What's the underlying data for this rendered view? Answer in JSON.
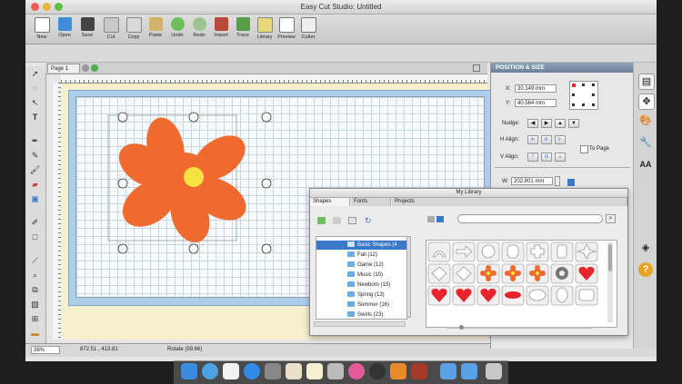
{
  "window": {
    "title": "Easy Cut Studio: Untitled"
  },
  "toolbar": {
    "items": [
      "New",
      "Open",
      "Save",
      "Cut",
      "Copy",
      "Paste",
      "Undo",
      "Redo",
      "Import",
      "Trace",
      "Library",
      "Preview",
      "Cutter"
    ]
  },
  "document": {
    "page_tab": "Page 1"
  },
  "status": {
    "zoom": "38%",
    "coords": "872.51 , 413.81",
    "message": "Rotate (59.66)"
  },
  "position_size": {
    "title": "POSITION & SIZE",
    "x_label": "X:",
    "x_value": "30.149 mm",
    "y_label": "Y:",
    "y_value": "40.564 mm",
    "nudge_label": "Nudge:",
    "h_align_label": "H Align:",
    "v_align_label": "V Align:",
    "to_page_label": "To Page",
    "w_label": "W:",
    "w_value": "202.801 mm"
  },
  "library": {
    "title": "My Library",
    "tabs": [
      "Shapes",
      "Fonts",
      "Projects"
    ],
    "tree": [
      {
        "label": "Basic Shapes (4",
        "selected": true
      },
      {
        "label": "Fall (12)"
      },
      {
        "label": "Game (12)"
      },
      {
        "label": "Music (10)"
      },
      {
        "label": "Newborn (15)"
      },
      {
        "label": "Spring (13)"
      },
      {
        "label": "Summer (16)"
      },
      {
        "label": "Swirls (23)"
      }
    ]
  },
  "colors": {
    "flower": "#ee6a2e",
    "flower_center": "#f6e340",
    "mat": "#aecdeb",
    "selection": "#3a78c9",
    "heart": "#e8232b"
  }
}
